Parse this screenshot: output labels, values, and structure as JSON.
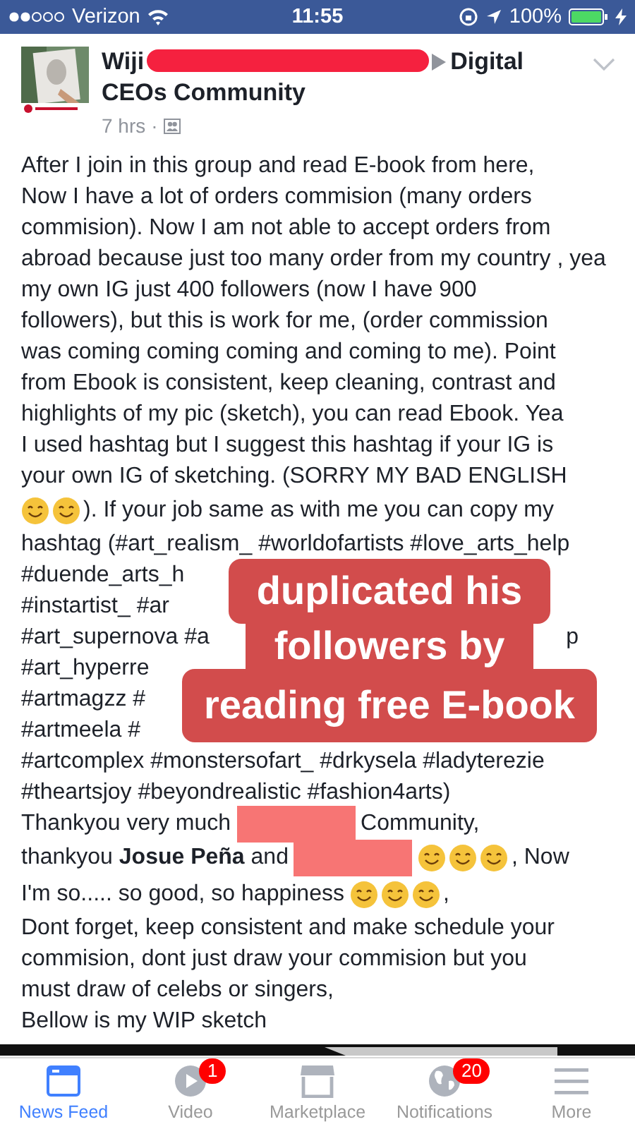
{
  "status_bar": {
    "carrier": "Verizon",
    "time": "11:55",
    "battery": "100%"
  },
  "post": {
    "author": "Wiji",
    "group": [
      "Digital",
      "CEOs Community"
    ],
    "time": "7 hrs",
    "separator": "·",
    "lines": [
      {
        "segments": [
          {
            "kind": "text",
            "text": "After I join in this group and read E-book from here,"
          }
        ]
      },
      {
        "segments": [
          {
            "kind": "text",
            "text": "Now I have a lot of orders commision (many orders"
          }
        ]
      },
      {
        "segments": [
          {
            "kind": "text",
            "text": "commision). Now I am not able to accept orders from"
          }
        ]
      },
      {
        "segments": [
          {
            "kind": "text",
            "text": "abroad because just too many order from my country , yea"
          }
        ]
      },
      {
        "segments": [
          {
            "kind": "text",
            "text": "my own IG just 400 followers (now I have 900"
          }
        ]
      },
      {
        "segments": [
          {
            "kind": "text",
            "text": "followers), but this is work for me, (order commission"
          }
        ]
      },
      {
        "segments": [
          {
            "kind": "text",
            "text": "was coming coming coming and coming to me). Point"
          }
        ]
      },
      {
        "segments": [
          {
            "kind": "text",
            "text": "from Ebook is consistent, keep cleaning, contrast and"
          }
        ]
      },
      {
        "segments": [
          {
            "kind": "text",
            "text": "highlights of my pic (sketch), you can read Ebook. Yea"
          }
        ]
      },
      {
        "segments": [
          {
            "kind": "text",
            "text": "I used hashtag but I suggest this hashtag if your IG is"
          }
        ]
      },
      {
        "segments": [
          {
            "kind": "text",
            "text": "your own IG of sketching. (SORRY MY BAD ENGLISH"
          }
        ]
      },
      {
        "segments": [
          {
            "kind": "emoji"
          },
          {
            "kind": "emoji"
          },
          {
            "kind": "text",
            "text": "). If your job same as with me you can copy my"
          }
        ]
      },
      {
        "segments": [
          {
            "kind": "text",
            "text": "hashtag (#art_realism_ #worldofartists #love_arts_help"
          }
        ]
      },
      {
        "segments": [
          {
            "kind": "text",
            "text": "#duende_arts_h"
          }
        ]
      },
      {
        "segments": [
          {
            "kind": "text",
            "text": "#instartist_ #ar"
          }
        ]
      },
      {
        "segments": [
          {
            "kind": "text",
            "text": "#art_supernova #a"
          }
        ],
        "right_text": "p"
      },
      {
        "segments": [
          {
            "kind": "text",
            "text": "#art_hyperre"
          }
        ]
      },
      {
        "segments": [
          {
            "kind": "text",
            "text": "#artmagzz #"
          }
        ]
      },
      {
        "segments": [
          {
            "kind": "text",
            "text": "#artmeela #"
          }
        ]
      },
      {
        "segments": [
          {
            "kind": "text",
            "text": "#artcomplex #monstersofart_ #drkysela #ladyterezie"
          }
        ]
      },
      {
        "segments": [
          {
            "kind": "text",
            "text": "#theartsjoy #beyondrealistic #fashion4arts)"
          }
        ]
      },
      {
        "segments": [
          {
            "kind": "text",
            "text": "Thankyou very much"
          },
          {
            "kind": "redacted"
          },
          {
            "kind": "text",
            "text": "Community,"
          }
        ]
      },
      {
        "segments": [
          {
            "kind": "text",
            "text": "thankyou **Josue Peña** and"
          },
          {
            "kind": "redacted"
          },
          {
            "kind": "emoji"
          },
          {
            "kind": "emoji"
          },
          {
            "kind": "emoji"
          },
          {
            "kind": "text",
            "text": ", Now"
          }
        ]
      },
      {
        "segments": [
          {
            "kind": "text",
            "text": "I'm so..... so good, so happiness"
          },
          {
            "kind": "emoji"
          },
          {
            "kind": "emoji"
          },
          {
            "kind": "emoji"
          },
          {
            "kind": "text",
            "text": ","
          }
        ]
      },
      {
        "segments": [
          {
            "kind": "text",
            "text": "Dont forget, keep consistent and make schedule your"
          }
        ]
      },
      {
        "segments": [
          {
            "kind": "text",
            "text": "commision, dont just draw your commision but you"
          }
        ]
      },
      {
        "segments": [
          {
            "kind": "text",
            "text": "must draw of celebs or singers,"
          }
        ]
      },
      {
        "segments": [
          {
            "kind": "text",
            "text": "Bellow is my WIP sketch"
          }
        ]
      }
    ]
  },
  "caption": [
    "duplicated his",
    "followers by",
    "reading free E-book"
  ],
  "tabs": [
    {
      "label": "News Feed",
      "selected": true
    },
    {
      "label": "Video",
      "selected": false,
      "badge": "1"
    },
    {
      "label": "Marketplace",
      "selected": false
    },
    {
      "label": "Notifications",
      "selected": false,
      "badge": "20"
    },
    {
      "label": "More",
      "selected": false
    }
  ]
}
